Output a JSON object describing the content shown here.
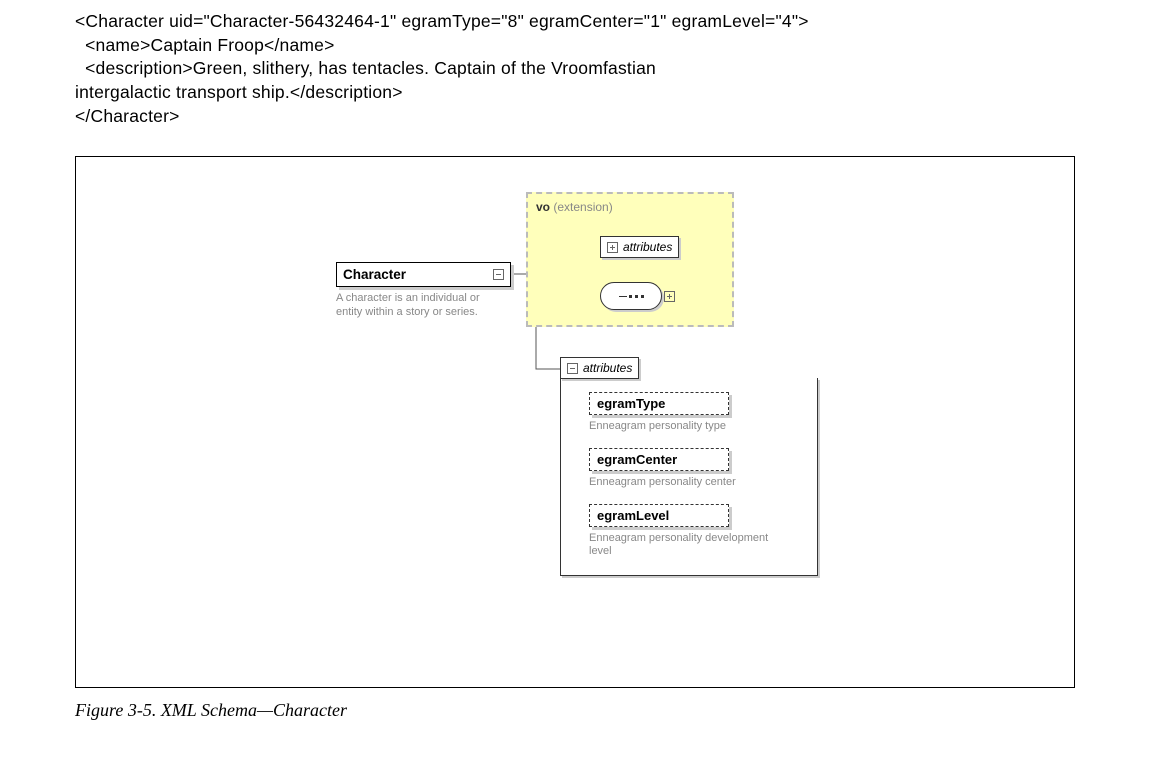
{
  "code": {
    "line1_open": "<Character uid=\"Character-56432464-1\" egramType=\"8\" egramCenter=\"1\" egramLevel=\"4\">",
    "line2_name": "  <name>Captain Froop</name>",
    "line3_desc_a": "  <description>Green, slithery, has tentacles. Captain of the Vroomfastian",
    "line3_desc_b": "intergalactic transport ship.</description>",
    "line4_close": "</Character>"
  },
  "diagram": {
    "character": {
      "label": "Character",
      "desc": "A character is an individual or entity within a story or series."
    },
    "vo": {
      "prefix": "vo",
      "suffix": "(extension)",
      "attributes_label": "attributes"
    },
    "attributes_panel": {
      "header": "attributes",
      "items": [
        {
          "name": "egramType",
          "desc": "Enneagram personality type"
        },
        {
          "name": "egramCenter",
          "desc": "Enneagram personality center"
        },
        {
          "name": "egramLevel",
          "desc": "Enneagram personality development level"
        }
      ]
    }
  },
  "caption": "Figure 3-5. XML Schema—Character"
}
